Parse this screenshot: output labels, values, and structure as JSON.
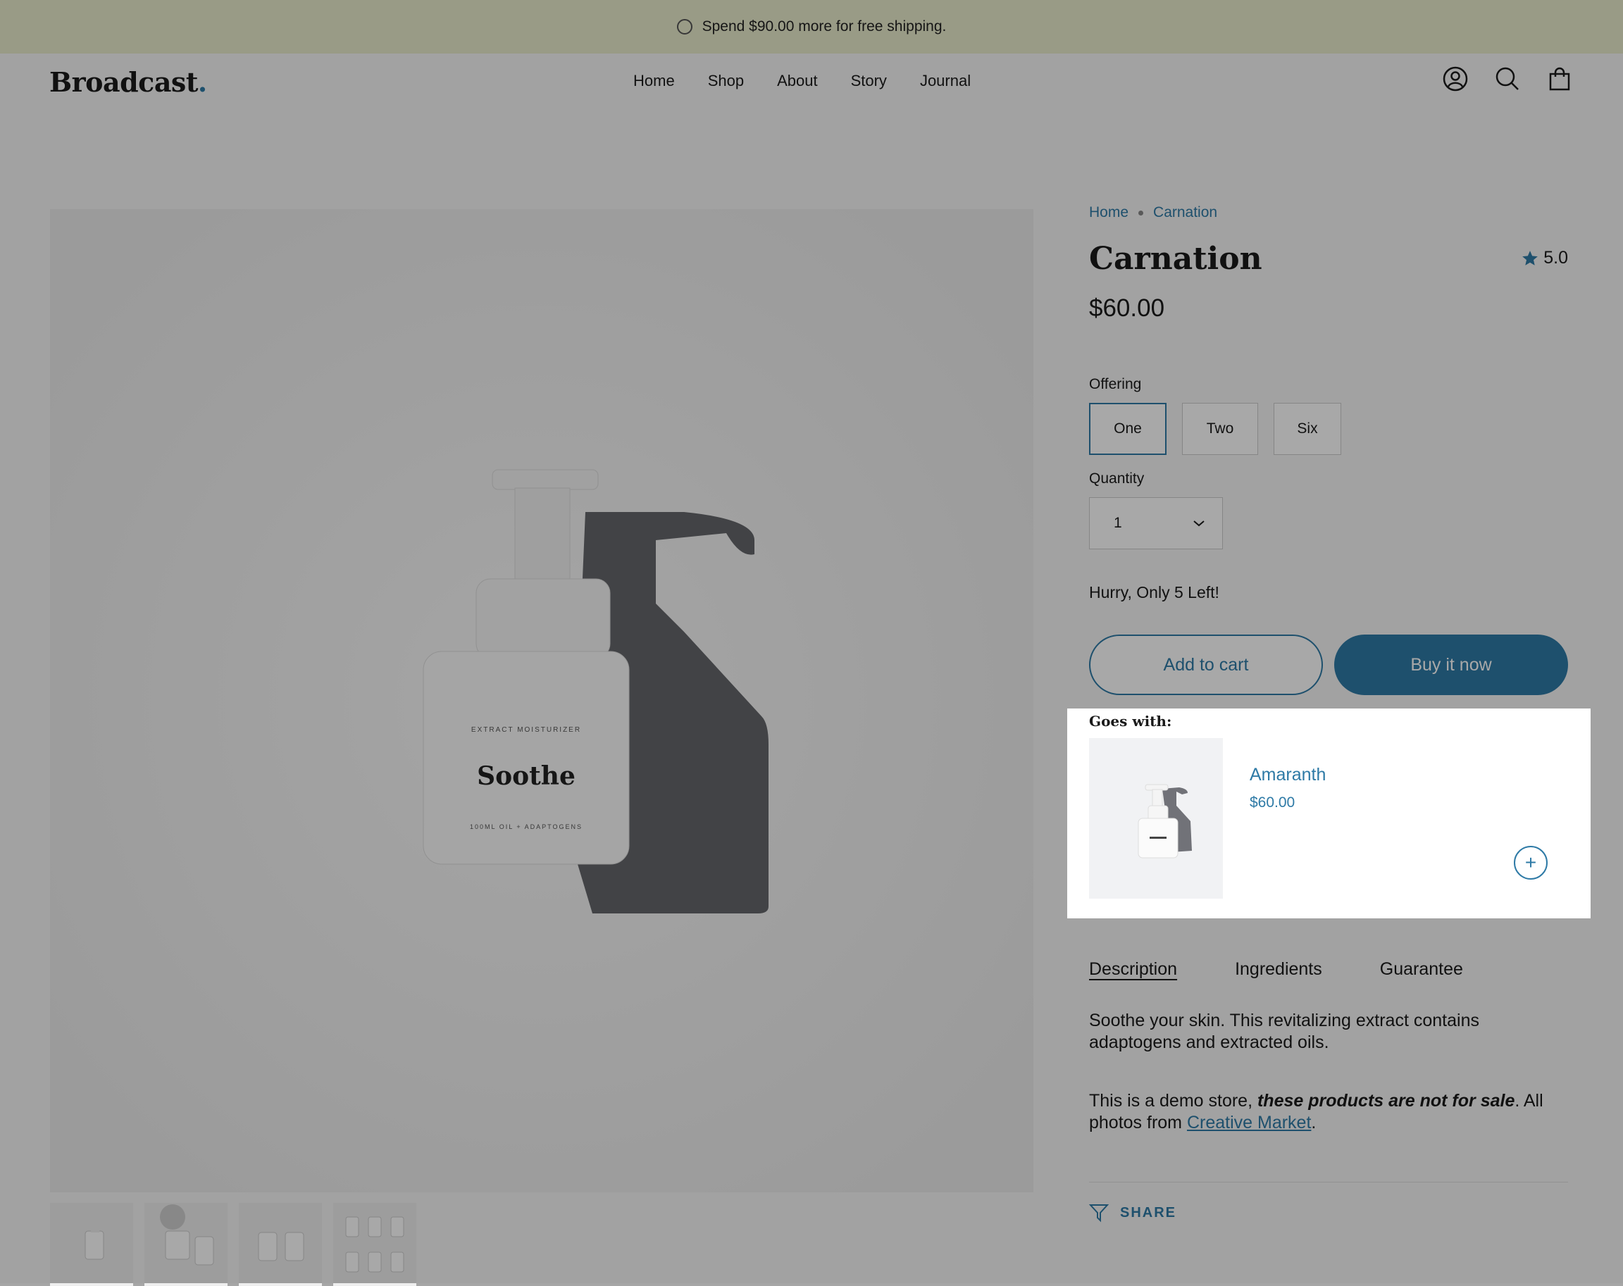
{
  "announcement": {
    "text": "Spend $90.00 more for free shipping."
  },
  "header": {
    "logo": "Broadcast",
    "logo_dot": ".",
    "nav": [
      "Home",
      "Shop",
      "About",
      "Story",
      "Journal"
    ],
    "icons": [
      "account-icon",
      "search-icon",
      "cart-icon"
    ]
  },
  "product": {
    "breadcrumb": [
      "Home",
      "Carnation"
    ],
    "title": "Carnation",
    "rating": "5.0",
    "price": "$60.00",
    "image_label": {
      "top": "EXTRACT MOISTURIZER",
      "name": "Soothe",
      "bottom": "100ML OIL + ADAPTOGENS"
    },
    "offering_label": "Offering",
    "offering_options": [
      "One",
      "Two",
      "Six"
    ],
    "offering_selected": "One",
    "quantity_label": "Quantity",
    "quantity_value": "1",
    "stock_text": "Hurry, Only 5 Left!",
    "add_to_cart": "Add to cart",
    "buy_now": "Buy it now"
  },
  "goes_with": {
    "label": "Goes with:",
    "item_name": "Amaranth",
    "item_price": "$60.00",
    "add_symbol": "+"
  },
  "tabs": [
    "Description",
    "Ingredients",
    "Guarantee"
  ],
  "description": {
    "p1": "Soothe your skin.  This revitalizing extract contains adaptogens and extracted oils.",
    "p2_a": "This is a demo store, ",
    "p2_b": "these products are not for sale",
    "p2_c": ". All photos from ",
    "p2_link": "Creative Market",
    "p2_d": "."
  },
  "share": "SHARE",
  "colors": {
    "accent": "#2e7aa6",
    "announcement_bg": "#e9ebcc",
    "overlay": "rgba(0,0,0,0.34)"
  }
}
